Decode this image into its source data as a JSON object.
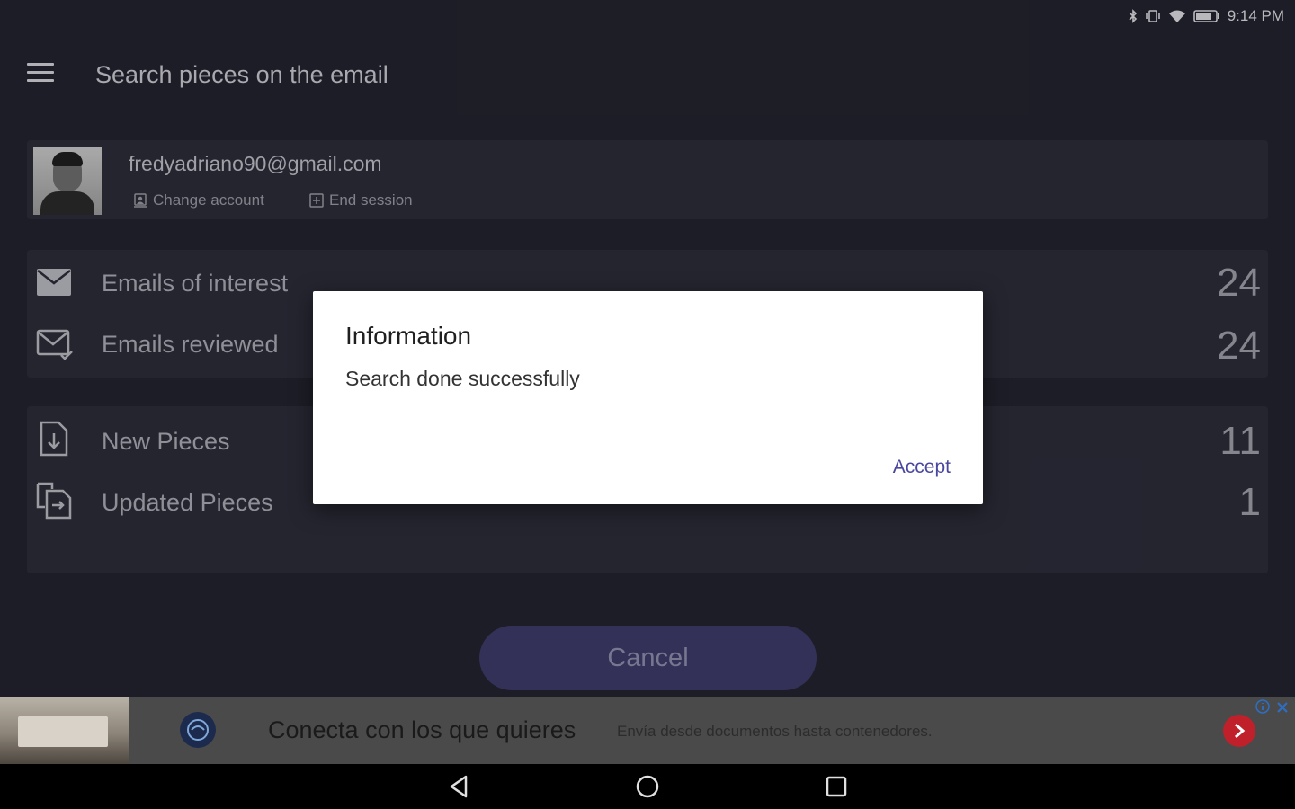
{
  "status": {
    "time": "9:14 PM"
  },
  "toolbar": {
    "title": "Search pieces on the email"
  },
  "account": {
    "email": "fredyadriano90@gmail.com",
    "change_account_label": "Change account",
    "end_session_label": "End session"
  },
  "stats": [
    {
      "label": "Emails of interest",
      "value": "24",
      "icon": "envelope-icon"
    },
    {
      "label": "Emails reviewed",
      "value": "24",
      "icon": "envelope-check-icon"
    }
  ],
  "pieces": [
    {
      "label": "New Pieces",
      "value": "11",
      "icon": "file-download-icon"
    },
    {
      "label": "Updated Pieces",
      "value": "1",
      "icon": "file-update-icon"
    }
  ],
  "cancel_label": "Cancel",
  "dialog": {
    "title": "Information",
    "message": "Search done successfully",
    "accept_label": "Accept"
  },
  "ad": {
    "headline": "Conecta con los que quieres",
    "subtext": "Envía desde documentos hasta contenedores.",
    "cta_color": "#c0202a"
  },
  "colors": {
    "accent": "#4a47a0",
    "background": "#23232e",
    "card": "#2c2c39"
  }
}
